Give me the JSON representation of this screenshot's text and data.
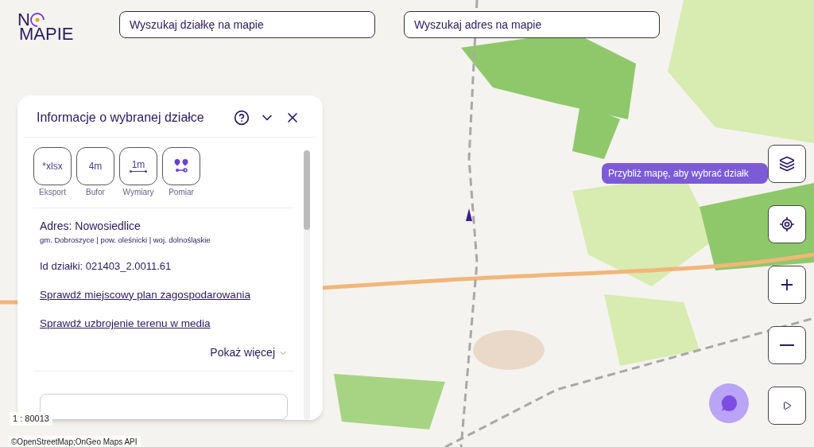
{
  "logo": {
    "first": "N",
    "second": "MAPIE"
  },
  "search_fields": [
    {
      "placeholder": "Wyszukaj działkę na mapie"
    },
    {
      "placeholder": "Wyszukaj adres na mapie"
    }
  ],
  "panel": {
    "title": "Informacje o wybranej działce",
    "tools": [
      {
        "kind": "text",
        "face": "*xlsx",
        "label": "Eksport"
      },
      {
        "kind": "text",
        "face": "4m",
        "label": "Bufor"
      },
      {
        "kind": "dimension",
        "face": "1m",
        "label": "Wymiary"
      },
      {
        "kind": "pins",
        "label": "Pomiar"
      }
    ],
    "address": "Adres: Nowosiedlice",
    "region": "gm. Dobroszyce | pow. oleśnicki | woj. dolnośląskie",
    "parcel_id": "Id działki: 021403_2.0011.61",
    "links": [
      "Sprawdź miejscowy plan zagospodarowania",
      "Sprawdź uzbrojenie terenu w media"
    ],
    "show_more": "Pokaż więcej"
  },
  "tooltip": "Przybliż mapę, aby wybrać działk",
  "scale": "1 : 80013",
  "attribution": "©OpenStreetMap;OnGeo Maps API"
}
